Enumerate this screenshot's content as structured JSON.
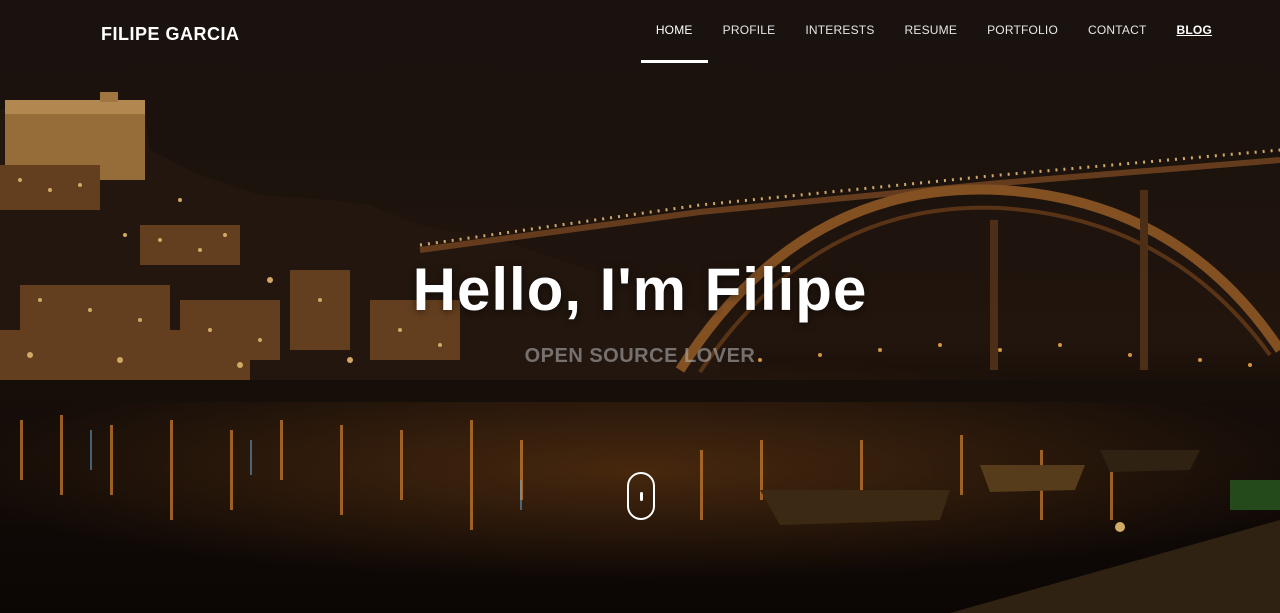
{
  "brand": {
    "name": "FILIPE GARCIA"
  },
  "nav": {
    "items": [
      {
        "label": "HOME"
      },
      {
        "label": "PROFILE"
      },
      {
        "label": "INTERESTS"
      },
      {
        "label": "RESUME"
      },
      {
        "label": "PORTFOLIO"
      },
      {
        "label": "CONTACT"
      },
      {
        "label": "BLOG"
      }
    ],
    "active": "HOME"
  },
  "hero": {
    "title": "Hello, I'm Filipe",
    "subtitle": "OPEN SOURCE LOVER",
    "scroll_icon": "mouse-scroll-icon"
  },
  "colors": {
    "text": "#ffffff",
    "nav_text": "#e6e6e6",
    "light_orange": "#ffb84d",
    "sky": "#1f1612",
    "water": "#0e0806"
  }
}
